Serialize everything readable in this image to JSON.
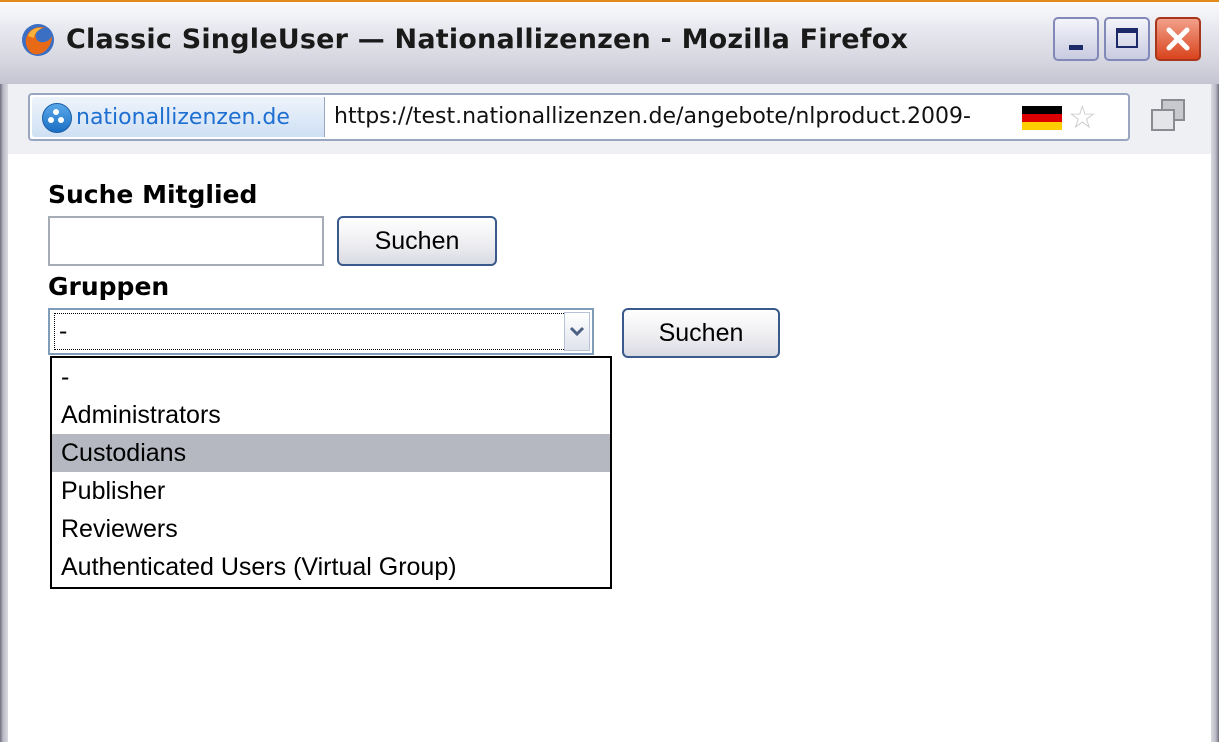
{
  "window": {
    "title": "Classic SingleUser — Nationallizenzen - Mozilla Firefox"
  },
  "urlbar": {
    "identity": "nationallizenzen.de",
    "url": "https://test.nationallizenzen.de/angebote/nlproduct.2009-"
  },
  "form": {
    "search_label": "Suche Mitglied",
    "search_value": "",
    "search_button": "Suchen",
    "groups_label": "Gruppen",
    "groups_selected": "-",
    "groups_button": "Suchen",
    "groups_options": [
      "-",
      "Administrators",
      "Custodians",
      "Publisher",
      "Reviewers",
      "Authenticated Users (Virtual Group)"
    ],
    "highlighted_option": "Custodians"
  },
  "colors": {
    "highlight": "#b5b8c0",
    "titlebar_accent": "#e38a1b"
  }
}
